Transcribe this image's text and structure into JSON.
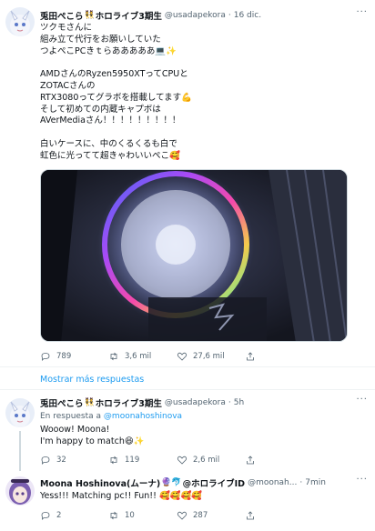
{
  "tweet1": {
    "name": "兎田ぺこら",
    "emoji_name": "👯",
    "suffix": "ホロライブ3期生",
    "handle": "@usadapekora",
    "dot": "·",
    "time": "16 dic.",
    "more": "···",
    "text": "ツクモさんに\n組み立て代行をお願いしていた\nつよぺこPCきｔらあああああ💻✨\n\nAMDさんのRyzen5950XTってCPUと\nZOTACさんの\nRTX3080ってグラボを搭載してます💪\nそして初めての内蔵キャプボは\nAVerMediaさん！！！！！！！！！\n\n白いケースに、中のくるくるも白で\n虹色に光ってて超きゃわいいぺこ🥰",
    "replies": "789",
    "retweets": "3,6 mil",
    "likes": "27,6 mil"
  },
  "show_more": "Mostrar más respuestas",
  "tweet2": {
    "name": "兎田ぺこら",
    "emoji_name": "👯",
    "suffix": "ホロライブ3期生",
    "handle": "@usadapekora",
    "dot": "·",
    "time": "5h",
    "more": "···",
    "reply_prefix": "En respuesta a",
    "reply_handle": "@moonahoshinova",
    "text": "Wooow! Moona!\nI'm happy to match😆✨",
    "replies": "32",
    "retweets": "119",
    "likes": "2,6 mil"
  },
  "tweet3": {
    "name": "Moona Hoshinova(ムーナ)",
    "emoji_name": "🔮🐬",
    "suffix": "@ホロライブID",
    "handle": "@moonah...",
    "dot": "·",
    "time": "7min",
    "more": "···",
    "text": "Yess!!! Matching pc!! Fun!! 🥰🥰🥰🥰",
    "replies": "2",
    "retweets": "10",
    "likes": "287"
  }
}
